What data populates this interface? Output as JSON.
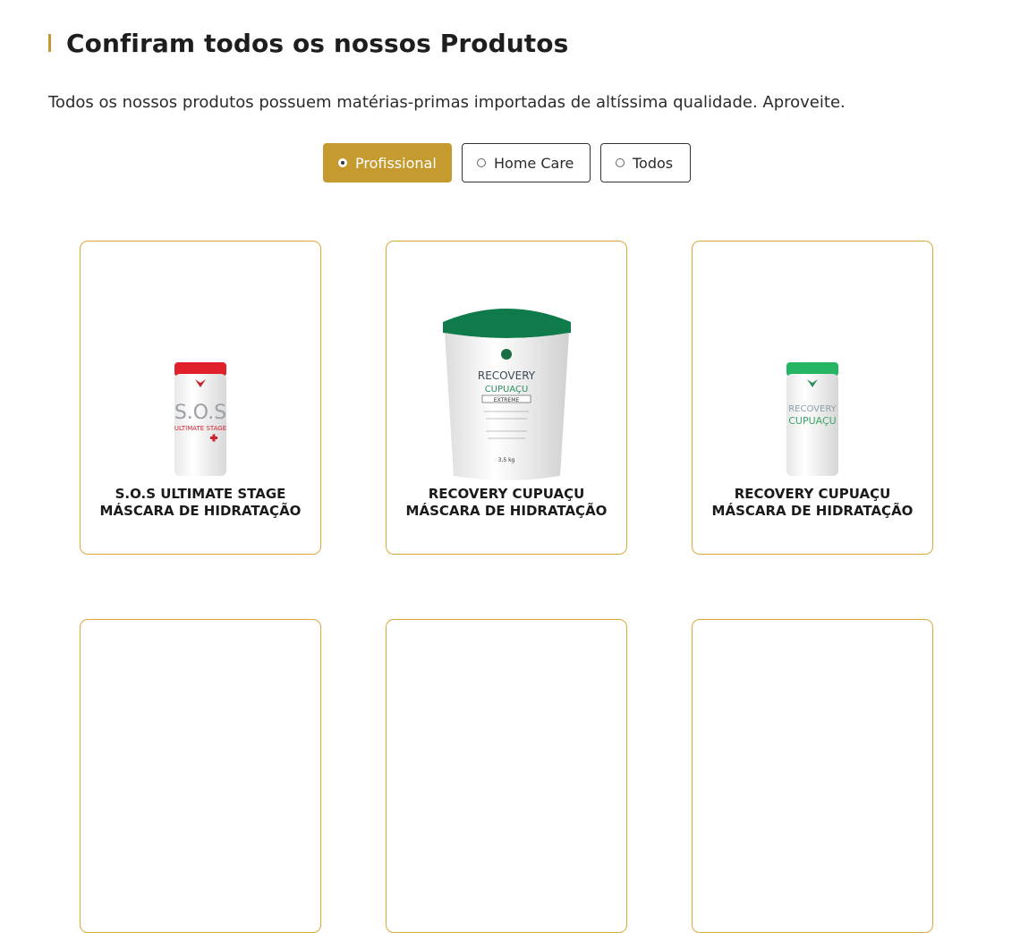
{
  "section": {
    "title": "Confiram todos os nossos Produtos",
    "subtitle": "Todos os nossos produtos possuem matérias-primas importadas de altíssima qualidade. Aproveite."
  },
  "filters": [
    {
      "label": "Profissional",
      "selected": true
    },
    {
      "label": "Home Care",
      "selected": false
    },
    {
      "label": "Todos",
      "selected": false
    }
  ],
  "colors": {
    "accent": "#c59a2e",
    "card_border": "#d9a93a"
  },
  "products": [
    {
      "name": "S.O.S ULTIMATE STAGE MÁSCARA DE HIDRATAÇÃO",
      "image_icon": "sos-jar-image",
      "label_lines": [
        "S.O.S",
        "ULTIMATE STAGE"
      ]
    },
    {
      "name": "RECOVERY CUPUAÇU MÁSCARA DE HIDRATAÇÃO",
      "image_icon": "recovery-bucket-image",
      "label_lines": [
        "RECOVERY",
        "CUPUAÇU",
        "EXTREME",
        "3,5 kg"
      ]
    },
    {
      "name": "RECOVERY CUPUAÇU MÁSCARA DE HIDRATAÇÃO",
      "image_icon": "recovery-jar-image",
      "label_lines": [
        "RECOVERY",
        "CUPUAÇU"
      ]
    }
  ]
}
